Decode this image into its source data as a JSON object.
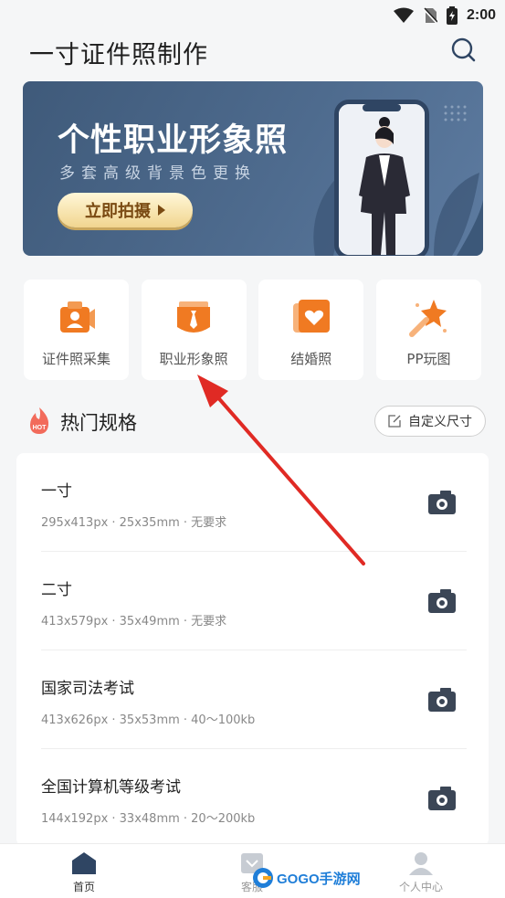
{
  "status_bar": {
    "time": "2:00"
  },
  "header": {
    "title": "一寸证件照制作"
  },
  "banner": {
    "title": "个性职业形象照",
    "subtitle": "多套高级背景色更换",
    "button_label": "立即拍摄"
  },
  "features": [
    {
      "label": "证件照采集",
      "icon": "id-photo-camera-icon"
    },
    {
      "label": "职业形象照",
      "icon": "business-tie-icon"
    },
    {
      "label": "结婚照",
      "icon": "heart-photo-icon"
    },
    {
      "label": "PP玩图",
      "icon": "magic-wand-icon"
    }
  ],
  "hot_section": {
    "title": "热门规格",
    "hot_badge": "HOT",
    "custom_button": "自定义尺寸"
  },
  "specs": [
    {
      "name": "一寸",
      "desc": "295x413px · 25x35mm · 无要求"
    },
    {
      "name": "二寸",
      "desc": "413x579px · 35x49mm · 无要求"
    },
    {
      "name": "国家司法考试",
      "desc": "413x626px · 35x53mm · 40～100kb"
    },
    {
      "name": "全国计算机等级考试",
      "desc": "144x192px · 33x48mm · 20～200kb"
    }
  ],
  "tabs": [
    {
      "label": "首页",
      "icon": "home-icon"
    },
    {
      "label": "客服",
      "icon": "customer-service-icon"
    },
    {
      "label": "个人中心",
      "icon": "user-icon"
    }
  ],
  "watermark": {
    "text": "GOGO手游网"
  },
  "colors": {
    "accent_orange": "#f07a22",
    "banner_blue": "#4e6b8e",
    "camera_dark": "#3b4656",
    "annotation_red": "#e02a24"
  }
}
